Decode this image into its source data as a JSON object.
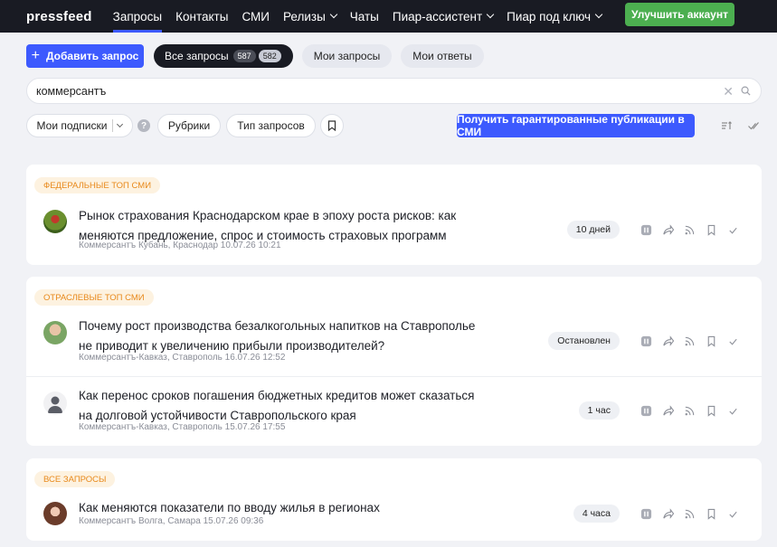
{
  "nav": {
    "logo": "pressfeed",
    "items": [
      {
        "label": "Запросы",
        "active": true,
        "dropdown": false
      },
      {
        "label": "Контакты",
        "active": false,
        "dropdown": false
      },
      {
        "label": "СМИ",
        "active": false,
        "dropdown": false
      },
      {
        "label": "Релизы",
        "active": false,
        "dropdown": true
      },
      {
        "label": "Чаты",
        "active": false,
        "dropdown": false
      },
      {
        "label": "Пиар-ассистент",
        "active": false,
        "dropdown": true
      },
      {
        "label": "Пиар под ключ",
        "active": false,
        "dropdown": true
      }
    ],
    "upgrade_label": "Улучшить аккаунт"
  },
  "tabs": {
    "add_label": "Добавить запрос",
    "all_label": "Все запросы",
    "all_count_1": "587",
    "all_count_2": "582",
    "mine_label": "Мои запросы",
    "answers_label": "Мои ответы"
  },
  "search": {
    "value": "коммерсантъ",
    "placeholder": ""
  },
  "filters": {
    "subscriptions_label": "Мои подписки",
    "help_glyph": "?",
    "rubrics_label": "Рубрики",
    "type_label": "Тип запросов",
    "guarantee_label": "Получить гарантированные публикации в СМИ"
  },
  "sections": [
    {
      "tag": "Федеральные топ СМИ",
      "items": [
        {
          "title": "Рынок страхования Краснодарском крае в эпоху роста рисков: как меняются предложение, спрос и стоимость страховых программ",
          "meta": "Коммерсантъ Кубань, Краснодар  10.07.26 10:21",
          "status": "10 дней",
          "avatar": "photo-green"
        }
      ]
    },
    {
      "tag": "Отраслевые топ СМИ",
      "items": [
        {
          "title": "Почему рост производства безалкогольных напитков на Ставрополье не приводит к увеличению прибыли производителей?",
          "meta": "Коммерсантъ-Кавказ, Ставрополь  16.07.26 12:52",
          "status": "Остановлен",
          "avatar": "photo-man"
        },
        {
          "title": "Как перенос сроков погашения бюджетных кредитов может сказаться на долговой устойчивости Ставропольского края",
          "meta": "Коммерсантъ-Кавказ, Ставрополь  15.07.26 17:55",
          "status": "1 час",
          "avatar": "silhouette"
        }
      ]
    },
    {
      "tag": "Все запросы",
      "items": [
        {
          "title": "Как меняются показатели по вводу жилья в регионах",
          "meta": "Коммерсантъ Волга, Самара  15.07.26 09:36",
          "status": "4 часа",
          "avatar": "photo-woman"
        }
      ]
    }
  ],
  "colors": {
    "nav_bg": "#191b23",
    "accent": "#3d5afe",
    "upgrade": "#4caf50",
    "tag_bg": "#fdf2e0",
    "tag_text": "#e8891b"
  }
}
